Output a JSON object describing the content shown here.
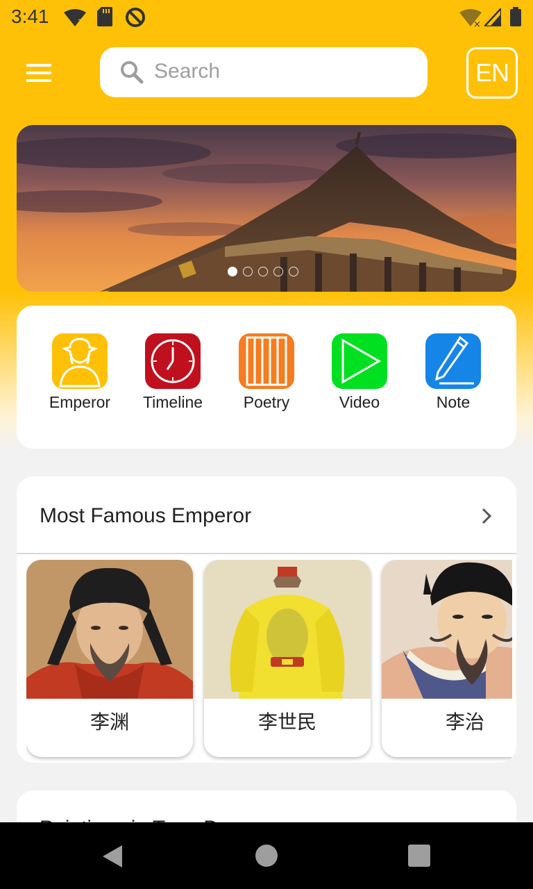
{
  "status_bar": {
    "time": "3:41",
    "icons": [
      "wifi-question-icon",
      "sd-card-icon",
      "sync-disabled-icon",
      "wifi-off-icon",
      "signal-icon",
      "battery-icon"
    ]
  },
  "header": {
    "menu_icon": "hamburger-menu-icon",
    "search": {
      "placeholder": "Search",
      "icon": "search-icon"
    },
    "language_button": "EN"
  },
  "banner": {
    "image": "tang-palace-sunset",
    "slide_count": 5,
    "active_slide": 1
  },
  "quick_menu": {
    "items": [
      {
        "label": "Emperor",
        "icon": "emperor-figure-icon",
        "color": "#FFC107"
      },
      {
        "label": "Timeline",
        "icon": "clock-icon",
        "color": "#C0101E"
      },
      {
        "label": "Poetry",
        "icon": "scroll-columns-icon",
        "color": "#F57C1F"
      },
      {
        "label": "Video",
        "icon": "play-icon",
        "color": "#00E020"
      },
      {
        "label": "Note",
        "icon": "pencil-icon",
        "color": "#1585E8"
      }
    ]
  },
  "famous_emperors": {
    "title": "Most Famous Emperor",
    "more_icon": "chevron-right-icon",
    "items": [
      {
        "name": "李渊",
        "portrait": "li-yuan-portrait"
      },
      {
        "name": "李世民",
        "portrait": "li-shimin-portrait"
      },
      {
        "name": "李治",
        "portrait": "li-zhi-portrait"
      }
    ]
  },
  "next_section": {
    "title": "Paintings in Tang Dy"
  },
  "nav_bar": {
    "back": "back-icon",
    "home": "home-icon",
    "recents": "recents-icon"
  },
  "colors": {
    "accent": "#FFC107",
    "background": "#F2F2F2"
  }
}
